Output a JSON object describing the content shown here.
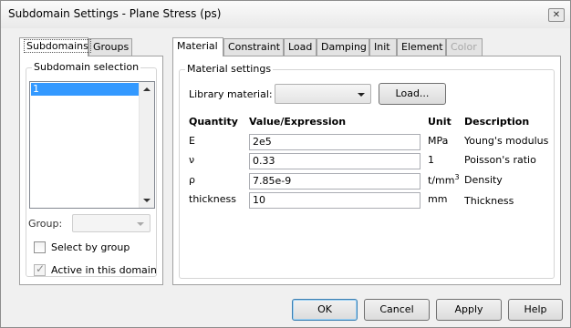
{
  "window": {
    "title": "Subdomain Settings - Plane Stress (ps)",
    "close_glyph": "✕"
  },
  "left_tabs": [
    {
      "label": "Subdomains",
      "active": true
    },
    {
      "label": "Groups",
      "active": false
    }
  ],
  "subdomain_selection": {
    "legend": "Subdomain selection",
    "items": [
      "1"
    ],
    "selected_index": 0
  },
  "group": {
    "label": "Group:",
    "value": ""
  },
  "select_by_group": {
    "label": "Select by group",
    "checked": false,
    "enabled": true
  },
  "active_in_domain": {
    "label": "Active in this domain",
    "checked": true,
    "enabled": false,
    "mark": "✓"
  },
  "right_tabs": [
    {
      "label": "Material",
      "active": true,
      "enabled": true
    },
    {
      "label": "Constraint",
      "active": false,
      "enabled": true
    },
    {
      "label": "Load",
      "active": false,
      "enabled": true
    },
    {
      "label": "Damping",
      "active": false,
      "enabled": true
    },
    {
      "label": "Init",
      "active": false,
      "enabled": true
    },
    {
      "label": "Element",
      "active": false,
      "enabled": true
    },
    {
      "label": "Color",
      "active": false,
      "enabled": false
    }
  ],
  "material_settings": {
    "legend": "Material settings",
    "library_label": "Library material:",
    "library_value": "",
    "load_button": "Load...",
    "headers": {
      "quantity": "Quantity",
      "value": "Value/Expression",
      "unit": "Unit",
      "description": "Description"
    },
    "rows": [
      {
        "quantity": "E",
        "value": "2e5",
        "unit": "MPa",
        "unit_sup": "",
        "description": "Young's modulus"
      },
      {
        "quantity": "ν",
        "value": "0.33",
        "unit": "1",
        "unit_sup": "",
        "description": "Poisson's ratio"
      },
      {
        "quantity": "ρ",
        "value": "7.85e-9",
        "unit": "t/mm",
        "unit_sup": "3",
        "description": "Density"
      },
      {
        "quantity": "thickness",
        "value": "10",
        "unit": "mm",
        "unit_sup": "",
        "description": "Thickness"
      }
    ]
  },
  "buttons": {
    "ok": "OK",
    "cancel": "Cancel",
    "apply": "Apply",
    "help": "Help"
  }
}
